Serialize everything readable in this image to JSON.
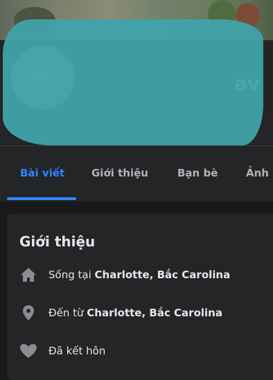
{
  "tabs": [
    {
      "label": "Bài viết"
    },
    {
      "label": "Giới thiệu"
    },
    {
      "label": "Bạn bè"
    },
    {
      "label": "Ảnh"
    }
  ],
  "profile": {
    "name_visible_tail": "av"
  },
  "intro": {
    "title": "Giới thiệu",
    "items": [
      {
        "prefix": "Sống tại",
        "value": "Charlotte, Bắc Carolina",
        "icon": "home-icon"
      },
      {
        "prefix": "Đến từ",
        "value": "Charlotte, Bắc Carolina",
        "icon": "location-pin-icon"
      },
      {
        "prefix": "Đã kết hôn",
        "value": "",
        "icon": "heart-icon"
      }
    ]
  },
  "colors": {
    "accent": "#2d88ff",
    "redaction": "#40a3aa",
    "card": "#242526",
    "page": "#18191a"
  }
}
